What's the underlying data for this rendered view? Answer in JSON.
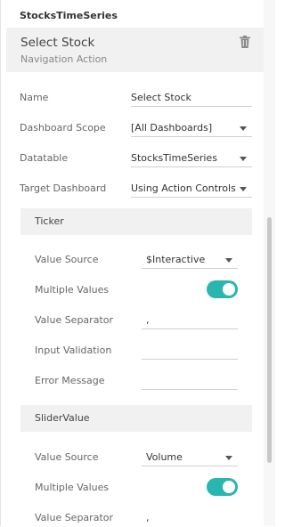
{
  "panel": {
    "header": "StocksTimeSeries",
    "action_title": "Select Stock",
    "action_subtitle": "Navigation Action"
  },
  "props": {
    "name_label": "Name",
    "name_value": "Select Stock",
    "scope_label": "Dashboard Scope",
    "scope_value": "[All Dashboards]",
    "datatable_label": "Datatable",
    "datatable_value": "StocksTimeSeries",
    "target_label": "Target Dashboard",
    "target_value": "Using Action Controls"
  },
  "ticker": {
    "title": "Ticker",
    "value_source_label": "Value Source",
    "value_source_value": "$Interactive",
    "multiple_values_label": "Multiple Values",
    "multiple_values_on": true,
    "separator_label": "Value Separator",
    "separator_value": ",",
    "validation_label": "Input Validation",
    "validation_value": "",
    "error_label": "Error Message",
    "error_value": ""
  },
  "slider": {
    "title": "SliderValue",
    "value_source_label": "Value Source",
    "value_source_value": "Volume",
    "multiple_values_label": "Multiple Values",
    "multiple_values_on": true,
    "separator_label": "Value Separator",
    "separator_value": ","
  },
  "colors": {
    "toggle_on": "#29b6b0",
    "section_bg": "#f1f1f1"
  }
}
